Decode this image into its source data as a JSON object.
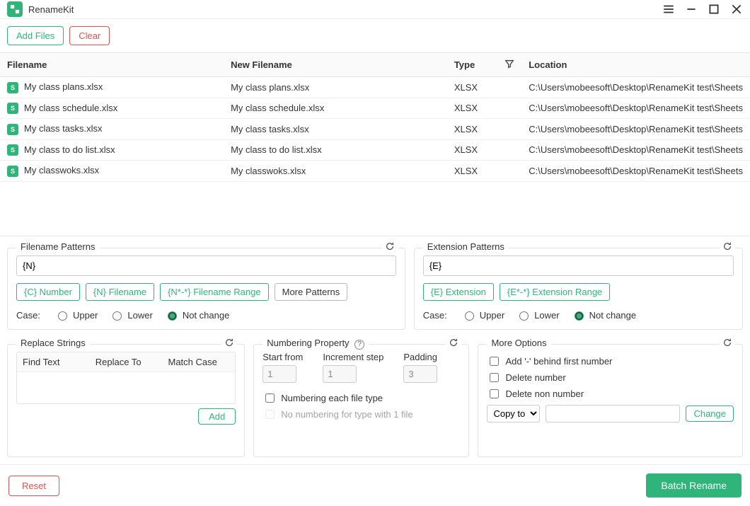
{
  "app": {
    "title": "RenameKit"
  },
  "toolbar": {
    "addFiles": "Add Files",
    "clear": "Clear"
  },
  "table": {
    "headers": {
      "filename": "Filename",
      "newFilename": "New Filename",
      "type": "Type",
      "location": "Location"
    },
    "rows": [
      {
        "filename": "My class plans.xlsx",
        "newFilename": "My class plans.xlsx",
        "type": "XLSX",
        "location": "C:\\Users\\mobeesoft\\Desktop\\RenameKit test\\Sheets"
      },
      {
        "filename": "My class schedule.xlsx",
        "newFilename": "My class schedule.xlsx",
        "type": "XLSX",
        "location": "C:\\Users\\mobeesoft\\Desktop\\RenameKit test\\Sheets"
      },
      {
        "filename": "My class tasks.xlsx",
        "newFilename": "My class tasks.xlsx",
        "type": "XLSX",
        "location": "C:\\Users\\mobeesoft\\Desktop\\RenameKit test\\Sheets"
      },
      {
        "filename": "My class to do list.xlsx",
        "newFilename": "My class to do list.xlsx",
        "type": "XLSX",
        "location": "C:\\Users\\mobeesoft\\Desktop\\RenameKit test\\Sheets"
      },
      {
        "filename": "My classwoks.xlsx",
        "newFilename": "My classwoks.xlsx",
        "type": "XLSX",
        "location": "C:\\Users\\mobeesoft\\Desktop\\RenameKit test\\Sheets"
      }
    ]
  },
  "filenamePatterns": {
    "title": "Filename Patterns",
    "value": "{N}",
    "chips": {
      "cNumber": "{C} Number",
      "nFilename": "{N} Filename",
      "nRange": "{N*-*} Filename Range",
      "more": "More Patterns"
    },
    "caseLabel": "Case:",
    "caseOptions": {
      "upper": "Upper",
      "lower": "Lower",
      "notChange": "Not change"
    }
  },
  "extensionPatterns": {
    "title": "Extension Patterns",
    "value": "{E}",
    "chips": {
      "eExt": "{E} Extension",
      "eRange": "{E*-*} Extension Range"
    },
    "caseLabel": "Case:",
    "caseOptions": {
      "upper": "Upper",
      "lower": "Lower",
      "notChange": "Not change"
    }
  },
  "replace": {
    "title": "Replace Strings",
    "cols": {
      "find": "Find Text",
      "replace": "Replace To",
      "match": "Match Case"
    },
    "add": "Add"
  },
  "numbering": {
    "title": "Numbering Property",
    "startLabel": "Start from",
    "startValue": "1",
    "stepLabel": "Increment step",
    "stepValue": "1",
    "padLabel": "Padding",
    "padValue": "3",
    "eachType": "Numbering each file type",
    "noNumSingle": "No numbering for type with 1 file"
  },
  "moreOptions": {
    "title": "More Options",
    "addDash": "Add '-' behind first number",
    "deleteNumber": "Delete number",
    "deleteNonNumber": "Delete non number",
    "copySelect": "Copy to",
    "change": "Change"
  },
  "footer": {
    "reset": "Reset",
    "batchRename": "Batch Rename"
  }
}
